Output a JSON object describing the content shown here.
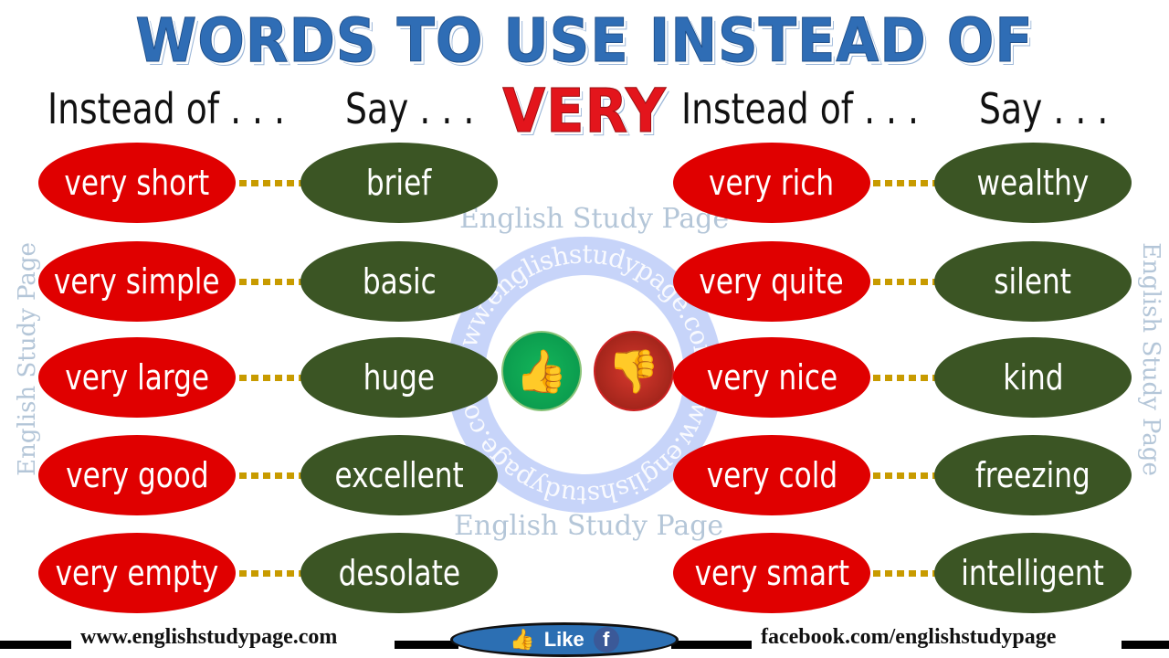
{
  "title": {
    "main": "WORDS TO USE INSTEAD OF",
    "highlight": "VERY"
  },
  "headers": {
    "instead_of": "Instead of . . .",
    "say": "Say . . ."
  },
  "left_pairs": [
    {
      "instead": "very short",
      "say": "brief"
    },
    {
      "instead": "very simple",
      "say": "basic"
    },
    {
      "instead": "very large",
      "say": "huge"
    },
    {
      "instead": "very good",
      "say": "excellent"
    },
    {
      "instead": "very empty",
      "say": "desolate"
    }
  ],
  "right_pairs": [
    {
      "instead": "very rich",
      "say": "wealthy"
    },
    {
      "instead": "very quite",
      "say": "silent"
    },
    {
      "instead": "very nice",
      "say": "kind"
    },
    {
      "instead": "very cold",
      "say": "freezing"
    },
    {
      "instead": "very smart",
      "say": "intelligent"
    }
  ],
  "watermark": {
    "text": "English Study Page",
    "ring_text": "www.englishstudypage.com"
  },
  "icons": {
    "good": "thumbs-up-icon",
    "bad": "thumbs-down-icon"
  },
  "footer": {
    "website": "www.englishstudypage.com",
    "like": "Like",
    "fb_letter": "f",
    "facebook": "facebook.com/englishstudypage"
  },
  "colors": {
    "red": "#e00000",
    "green": "#3b5524",
    "title_blue": "#2f6db5",
    "connector": "#c89b00"
  }
}
